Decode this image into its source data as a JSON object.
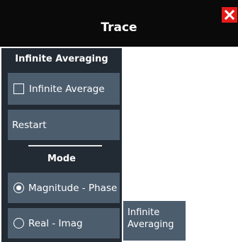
{
  "window": {
    "title": "Trace",
    "close_icon": "close-icon"
  },
  "colors": {
    "titlebar_bg": "#0a0a0a",
    "panel_bg": "#222a33",
    "button_bg": "#4c5d6e",
    "close_bg": "#e31b1b",
    "text": "#ffffff"
  },
  "averaging": {
    "header": "Infinite Averaging",
    "infinite_average_label": "Infinite Average",
    "infinite_average_checked": false,
    "restart_label": "Restart"
  },
  "mode": {
    "header": "Mode",
    "options": [
      {
        "label": "Magnitude - Phase",
        "selected": true
      },
      {
        "label": "Real - Imag",
        "selected": false
      }
    ]
  },
  "side_tab": {
    "line1": "Infinite",
    "line2": "Averaging"
  }
}
